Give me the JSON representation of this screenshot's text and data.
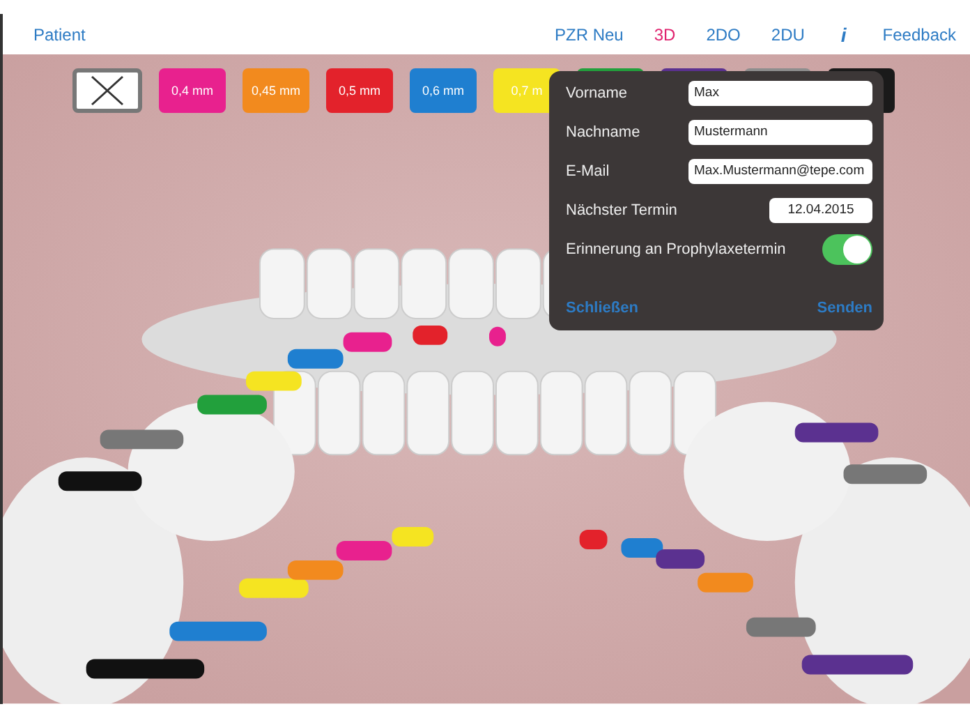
{
  "nav": {
    "left": "Patient",
    "items": [
      {
        "label": "PZR Neu",
        "selected": false
      },
      {
        "label": "3D",
        "selected": true
      },
      {
        "label": "2DO",
        "selected": false
      },
      {
        "label": "2DU",
        "selected": false
      }
    ],
    "info": "i",
    "feedback": "Feedback"
  },
  "chips": [
    {
      "kind": "clear"
    },
    {
      "kind": "size",
      "label": "0,4 mm",
      "color": "#e8218e"
    },
    {
      "kind": "size",
      "label": "0,45 mm",
      "color": "#f28a1e"
    },
    {
      "kind": "size",
      "label": "0,5 mm",
      "color": "#e3222b"
    },
    {
      "kind": "size",
      "label": "0,6 mm",
      "color": "#1f7fd0"
    },
    {
      "kind": "size",
      "label": "0,7 m",
      "color": "#f5e421"
    },
    {
      "kind": "size",
      "color": "#22a03c"
    },
    {
      "kind": "size",
      "color": "#5b3190"
    },
    {
      "kind": "size",
      "color": "#8e8e8e"
    },
    {
      "kind": "size",
      "color": "#1a1a1a"
    }
  ],
  "dialog": {
    "fields": [
      {
        "label": "Vorname",
        "value": "Max",
        "kind": "wide"
      },
      {
        "label": "Nachname",
        "value": "Mustermann",
        "kind": "wide"
      },
      {
        "label": "E-Mail",
        "value": "Max.Mustermann@tepe.com",
        "kind": "wide"
      },
      {
        "label": "Nächster Termin",
        "value": "12.04.2015",
        "kind": "date"
      }
    ],
    "reminder": {
      "label": "Erinnerung an Prophylaxetermin",
      "on": true
    },
    "close": "Schließen",
    "send": "Senden"
  }
}
